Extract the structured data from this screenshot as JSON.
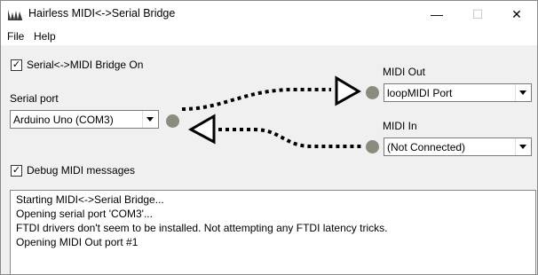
{
  "window": {
    "title": "Hairless MIDI<->Serial Bridge",
    "minimize_glyph": "—",
    "maximize_glyph": "☐",
    "close_glyph": "✕"
  },
  "menu": {
    "file": "File",
    "help": "Help"
  },
  "bridge": {
    "toggle_label": "Serial<->MIDI Bridge On",
    "checked": true
  },
  "serial": {
    "label": "Serial port",
    "selected": "Arduino Uno (COM3)"
  },
  "midi_out": {
    "label": "MIDI Out",
    "selected": "loopMIDI Port"
  },
  "midi_in": {
    "label": "MIDI In",
    "selected": "(Not Connected)"
  },
  "debug": {
    "label": "Debug MIDI messages",
    "checked": true
  },
  "log": {
    "lines": [
      "Starting MIDI<->Serial Bridge...",
      "Opening serial port 'COM3'...",
      "FTDI drivers don't seem to be installed. Not attempting any FTDI latency tricks.",
      "Opening MIDI Out port #1"
    ]
  },
  "icons": {
    "app": "hairless-app-icon",
    "dropdown": "chevron-down-icon",
    "check": "checkmark-icon",
    "arrow_out": "arrow-right-icon",
    "arrow_in": "arrow-left-icon"
  },
  "colors": {
    "port_dot": "#8c8c7e",
    "connector": "#000000"
  }
}
